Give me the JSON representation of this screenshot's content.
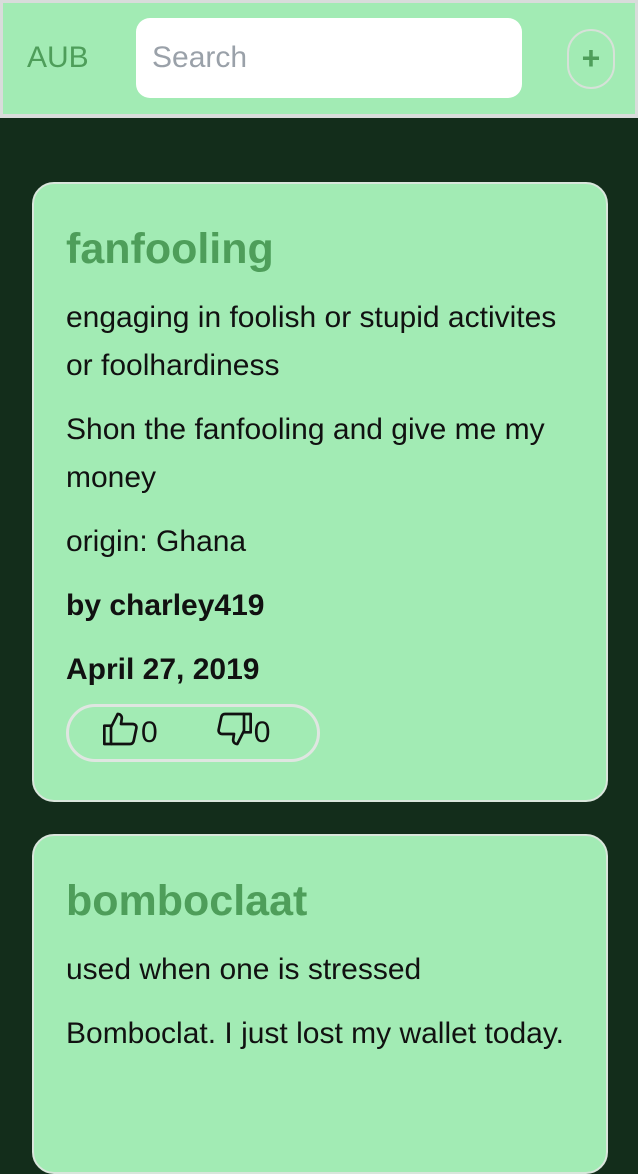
{
  "header": {
    "logo": "AUB",
    "search_placeholder": "Search",
    "add_label": "+"
  },
  "entries": [
    {
      "word": "fanfooling",
      "definition": "engaging in foolish or stupid activites or foolhardiness",
      "example": "Shon the fanfooling and give me my money",
      "origin": "origin: Ghana",
      "author": "by charley419",
      "date": "April 27, 2019",
      "upvotes": "0",
      "downvotes": "0"
    },
    {
      "word": "bomboclaat",
      "definition": "used when one is stressed",
      "example": "Bomboclat. I just lost my wallet today."
    }
  ],
  "icons": {
    "thumbs_up": "thumbs-up-icon",
    "thumbs_down": "thumbs-down-icon"
  },
  "colors": {
    "background": "#132d1b",
    "card": "#a2ebb4",
    "accent": "#4e9e5a"
  }
}
